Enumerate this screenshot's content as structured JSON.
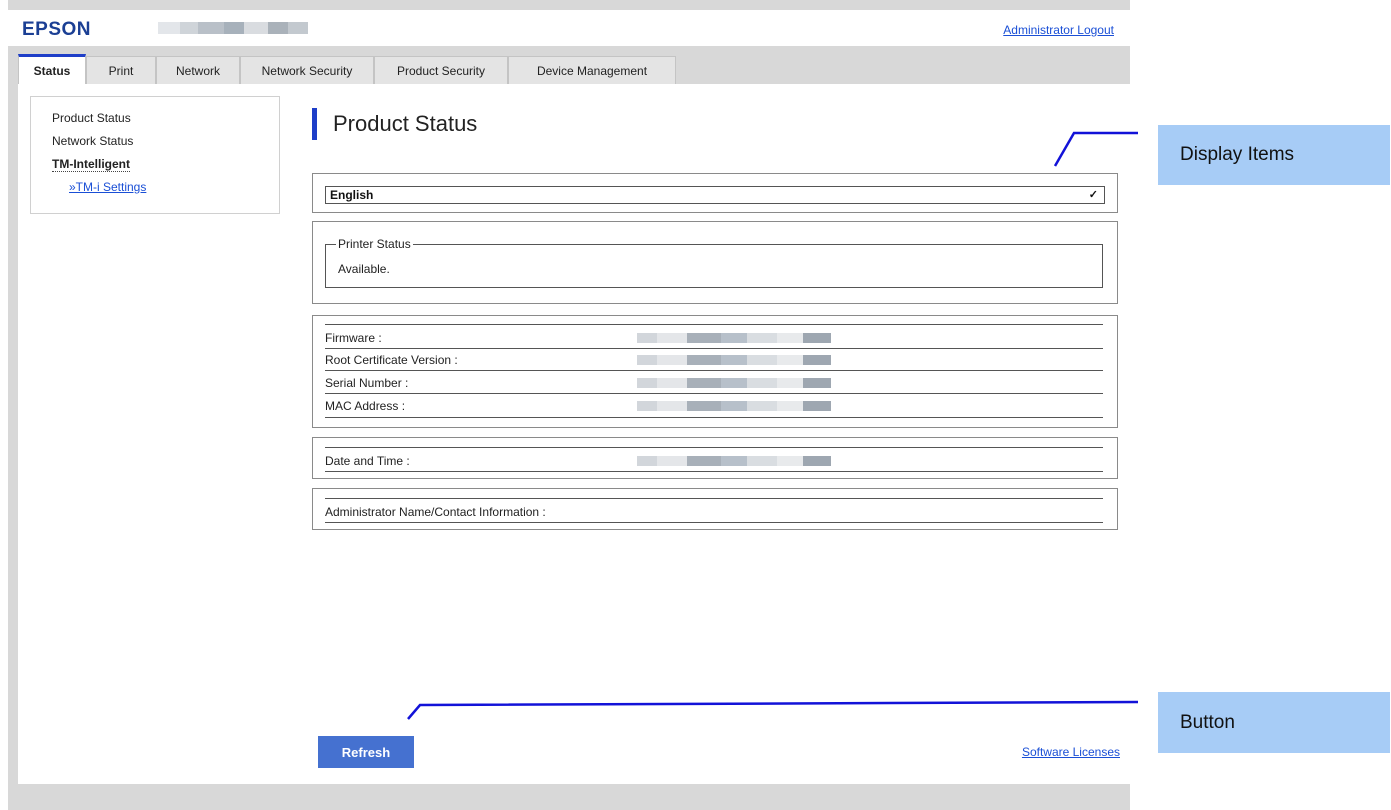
{
  "header": {
    "logo": "EPSON",
    "logout_label": "Administrator Logout"
  },
  "tabs": [
    {
      "label": "Status"
    },
    {
      "label": "Print"
    },
    {
      "label": "Network"
    },
    {
      "label": "Network Security"
    },
    {
      "label": "Product Security"
    },
    {
      "label": "Device Management"
    }
  ],
  "sidebar": {
    "items": [
      {
        "label": "Product Status"
      },
      {
        "label": "Network Status"
      },
      {
        "label": "TM-Intelligent"
      },
      {
        "label": "»TM-i Settings"
      }
    ]
  },
  "main": {
    "title": "Product Status",
    "language_select": "English",
    "printer_status_legend": "Printer Status",
    "printer_status_value": "Available.",
    "info_rows": [
      {
        "label": "Firmware :"
      },
      {
        "label": "Root Certificate Version :"
      },
      {
        "label": "Serial Number :"
      },
      {
        "label": "MAC Address :"
      }
    ],
    "date_time_label": "Date and Time :",
    "admin_label": "Administrator Name/Contact Information :",
    "refresh_label": "Refresh",
    "licenses_label": "Software Licenses"
  },
  "callouts": {
    "display_items": "Display Items",
    "button": "Button"
  },
  "colors": {
    "accent": "#1e3ec8",
    "logo": "#1b3f94",
    "link": "#1a4fd6",
    "button": "#4571d0",
    "callout_bg": "#a7ccf6",
    "callout_line": "#1212d8"
  }
}
